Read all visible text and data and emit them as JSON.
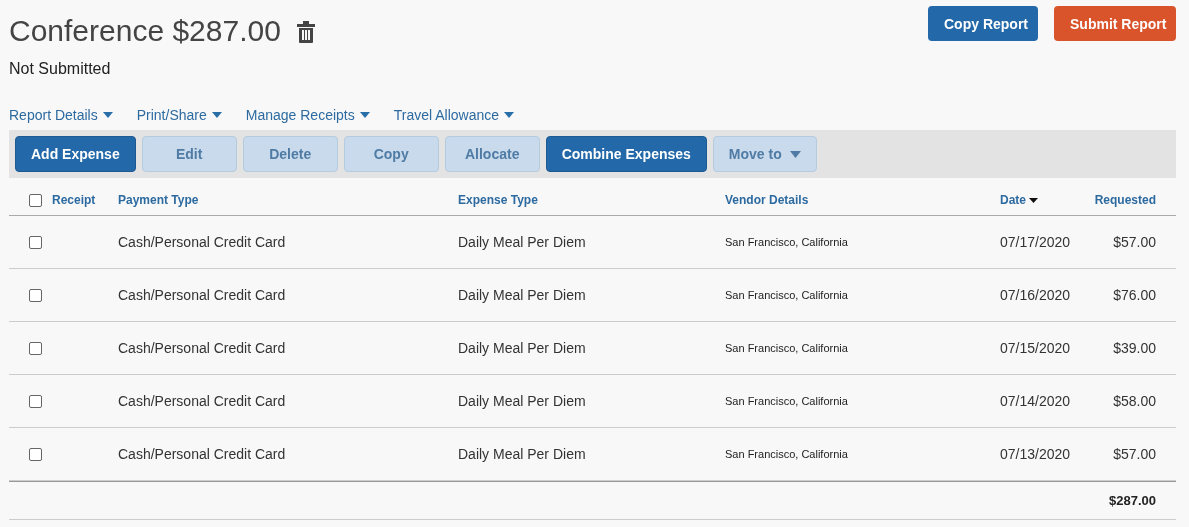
{
  "report": {
    "title": "Conference $287.00",
    "status": "Not Submitted"
  },
  "header_buttons": [
    {
      "label": "Copy Report",
      "kind": "primary"
    },
    {
      "label": "Submit Report",
      "kind": "submit"
    }
  ],
  "menus": [
    "Report Details",
    "Print/Share",
    "Manage Receipts",
    "Travel Allowance"
  ],
  "toolbar": [
    {
      "label": "Add Expense",
      "disabled": false,
      "dropdown": false
    },
    {
      "label": "Edit",
      "disabled": true,
      "dropdown": false
    },
    {
      "label": "Delete",
      "disabled": true,
      "dropdown": false
    },
    {
      "label": "Copy",
      "disabled": true,
      "dropdown": false
    },
    {
      "label": "Allocate",
      "disabled": true,
      "dropdown": false
    },
    {
      "label": "Combine Expenses",
      "disabled": false,
      "dropdown": false
    },
    {
      "label": "Move to",
      "disabled": true,
      "dropdown": true
    }
  ],
  "table": {
    "select_all_checked": false,
    "columns": [
      {
        "label": "Receipt",
        "sorted": false
      },
      {
        "label": "Payment Type",
        "sorted": false
      },
      {
        "label": "Expense Type",
        "sorted": false
      },
      {
        "label": "Vendor Details",
        "sorted": false
      },
      {
        "label": "Date",
        "sorted": true
      },
      {
        "label": "Requested",
        "sorted": false
      }
    ],
    "rows": [
      {
        "checked": false,
        "payment_type": "Cash/Personal Credit Card",
        "expense_type": "Daily Meal Per Diem",
        "vendor": "San Francisco, California",
        "date": "07/17/2020",
        "amount": "$57.00"
      },
      {
        "checked": false,
        "payment_type": "Cash/Personal Credit Card",
        "expense_type": "Daily Meal Per Diem",
        "vendor": "San Francisco, California",
        "date": "07/16/2020",
        "amount": "$76.00"
      },
      {
        "checked": false,
        "payment_type": "Cash/Personal Credit Card",
        "expense_type": "Daily Meal Per Diem",
        "vendor": "San Francisco, California",
        "date": "07/15/2020",
        "amount": "$39.00"
      },
      {
        "checked": false,
        "payment_type": "Cash/Personal Credit Card",
        "expense_type": "Daily Meal Per Diem",
        "vendor": "San Francisco, California",
        "date": "07/14/2020",
        "amount": "$58.00"
      },
      {
        "checked": false,
        "payment_type": "Cash/Personal Credit Card",
        "expense_type": "Daily Meal Per Diem",
        "vendor": "San Francisco, California",
        "date": "07/13/2020",
        "amount": "$57.00"
      }
    ],
    "total": "$287.00"
  }
}
